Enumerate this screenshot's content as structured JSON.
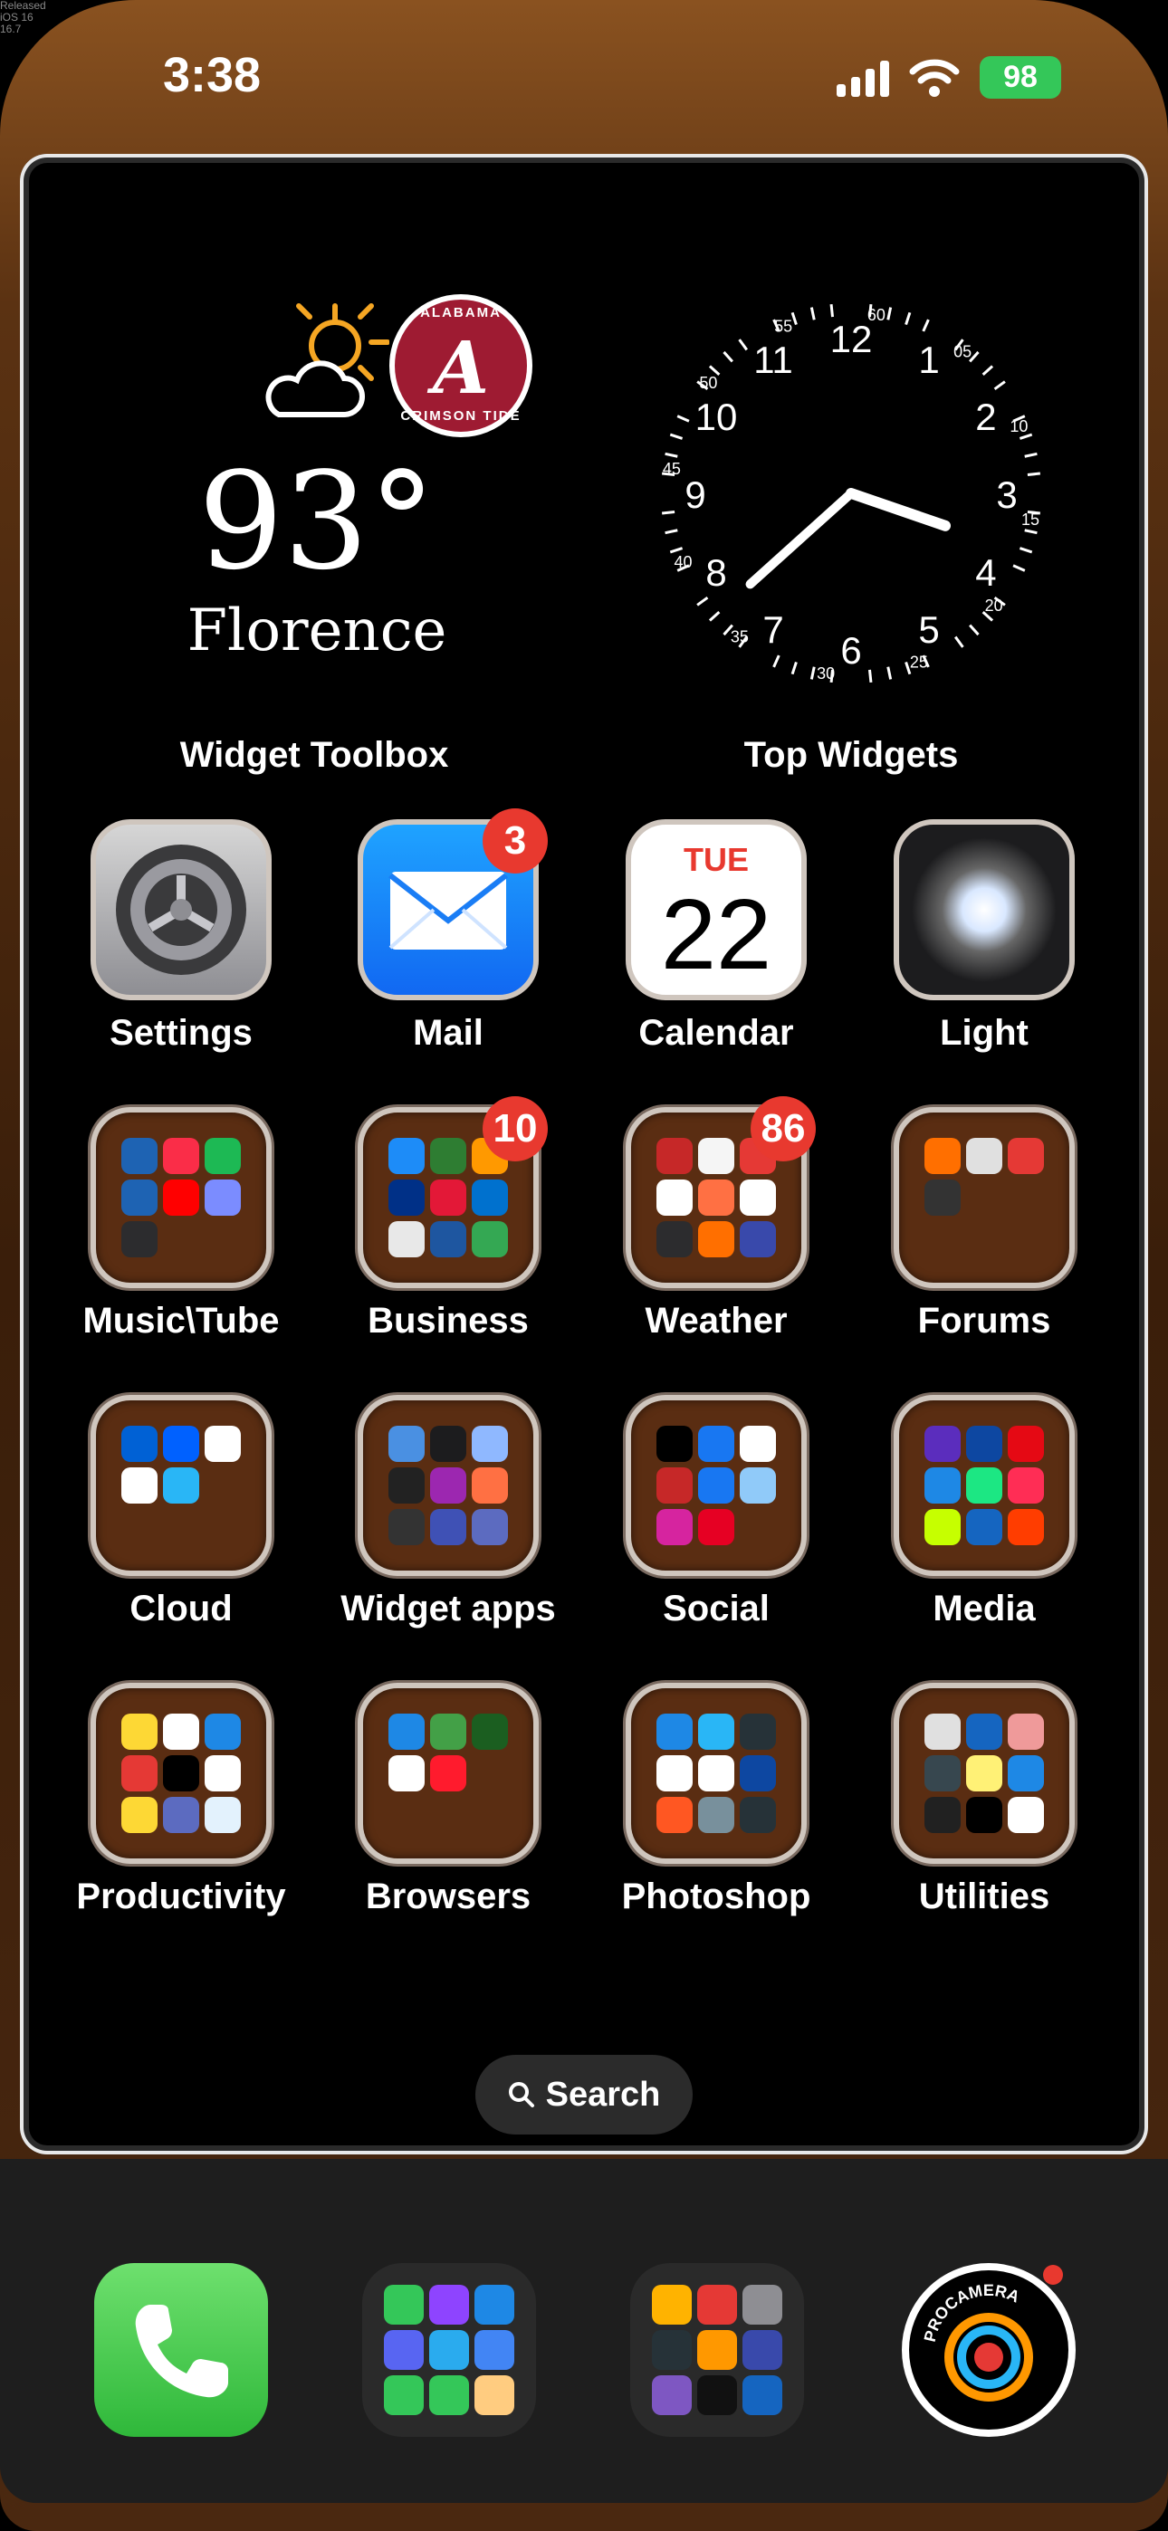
{
  "watermark": [
    "Released",
    "iOS 16",
    "16.7"
  ],
  "status": {
    "time": "3:38",
    "battery": "98"
  },
  "weather": {
    "temp": "93°",
    "city": "Florence",
    "team_top": "ALABAMA",
    "team_bottom": "CRIMSON TIDE",
    "team_letter": "A"
  },
  "clock": {
    "hour": 3,
    "minute": 38
  },
  "widget_labels": [
    "Widget Toolbox",
    "Top Widgets"
  ],
  "apps": [
    {
      "label": "Settings",
      "kind": "settings"
    },
    {
      "label": "Mail",
      "kind": "mail",
      "badge": "3"
    },
    {
      "label": "Calendar",
      "kind": "calendar",
      "dow": "TUE",
      "day": "22"
    },
    {
      "label": "Light",
      "kind": "light"
    },
    {
      "label": "Music\\Tube",
      "kind": "folder",
      "colors": [
        "#1e63b3",
        "#fa2d48",
        "#1db954",
        "#1e63b3",
        "#ff0000",
        "#7b8cff",
        "#2c2c2e"
      ]
    },
    {
      "label": "Business",
      "kind": "folder",
      "badge": "10",
      "colors": [
        "#1d8cf8",
        "#2e7d32",
        "#ff9900",
        "#003087",
        "#e31837",
        "#0071ce",
        "#e8e8e8",
        "#1e56a0",
        "#34a853"
      ]
    },
    {
      "label": "Weather",
      "kind": "folder",
      "badge": "86",
      "colors": [
        "#c62828",
        "#f5f5f5",
        "#e53935",
        "#ffffff",
        "#ff7043",
        "#ffffff",
        "#2c2c2e",
        "#ff6f00",
        "#3949ab"
      ]
    },
    {
      "label": "Forums",
      "kind": "folder",
      "colors": [
        "#ff6f00",
        "#e0e0e0",
        "#e53935",
        "#333333"
      ]
    },
    {
      "label": "Cloud",
      "kind": "folder",
      "colors": [
        "#0061d5",
        "#0061ff",
        "#ffffff",
        "#ffffff",
        "#29b6f6"
      ]
    },
    {
      "label": "Widget apps",
      "kind": "folder",
      "colors": [
        "#4a90e2",
        "#1c1c1e",
        "#8fb8ff",
        "#222222",
        "#9c27b0",
        "#ff7043",
        "#333333",
        "#3f51b5",
        "#5c6bc0"
      ]
    },
    {
      "label": "Social",
      "kind": "folder",
      "colors": [
        "#000000",
        "#1877f2",
        "#ffffff",
        "#c62828",
        "#1877f2",
        "#90caf9",
        "#d6249f",
        "#e60023"
      ]
    },
    {
      "label": "Media",
      "kind": "folder",
      "colors": [
        "#5b2dbd",
        "#0d47a1",
        "#e50914",
        "#1e88e5",
        "#1ce783",
        "#ff2d55",
        "#c6ff00",
        "#1565c0",
        "#ff3d00"
      ]
    },
    {
      "label": "Productivity",
      "kind": "folder",
      "colors": [
        "#fdd835",
        "#ffffff",
        "#1e88e5",
        "#e53935",
        "#000000",
        "#ffffff",
        "#fdd835",
        "#5c6bc0",
        "#e3f2fd"
      ]
    },
    {
      "label": "Browsers",
      "kind": "folder",
      "colors": [
        "#1e88e5",
        "#43a047",
        "#1b5e20",
        "#ffffff",
        "#ff1b2d"
      ]
    },
    {
      "label": "Photoshop",
      "kind": "folder",
      "colors": [
        "#1e88e5",
        "#29b6f6",
        "#263238",
        "#ffffff",
        "#ffffff",
        "#0d47a1",
        "#ff5722",
        "#78909c",
        "#263238"
      ]
    },
    {
      "label": "Utilities",
      "kind": "folder",
      "colors": [
        "#e0e0e0",
        "#1565c0",
        "#ef9a9a",
        "#37474f",
        "#fff176",
        "#1e88e5",
        "#212121",
        "#000000",
        "#ffffff"
      ]
    }
  ],
  "search": {
    "label": "Search"
  },
  "dock": [
    {
      "name": "Phone",
      "kind": "phone"
    },
    {
      "name": "Messaging folder",
      "kind": "folder",
      "colors": [
        "#34c759",
        "#8e44ff",
        "#1e88e5",
        "#5865f2",
        "#2aabee",
        "#4285f4",
        "#34c759",
        "#34c759",
        "#ffcc80"
      ]
    },
    {
      "name": "Photos folder",
      "kind": "folder",
      "colors": [
        "#ffb300",
        "#e53935",
        "#8e8e93",
        "#263238",
        "#ff9800",
        "#3949ab",
        "#7e57c2",
        "#111111",
        "#1565c0"
      ]
    },
    {
      "name": "ProCamera",
      "kind": "procam",
      "label": "PROCAMERA"
    }
  ]
}
